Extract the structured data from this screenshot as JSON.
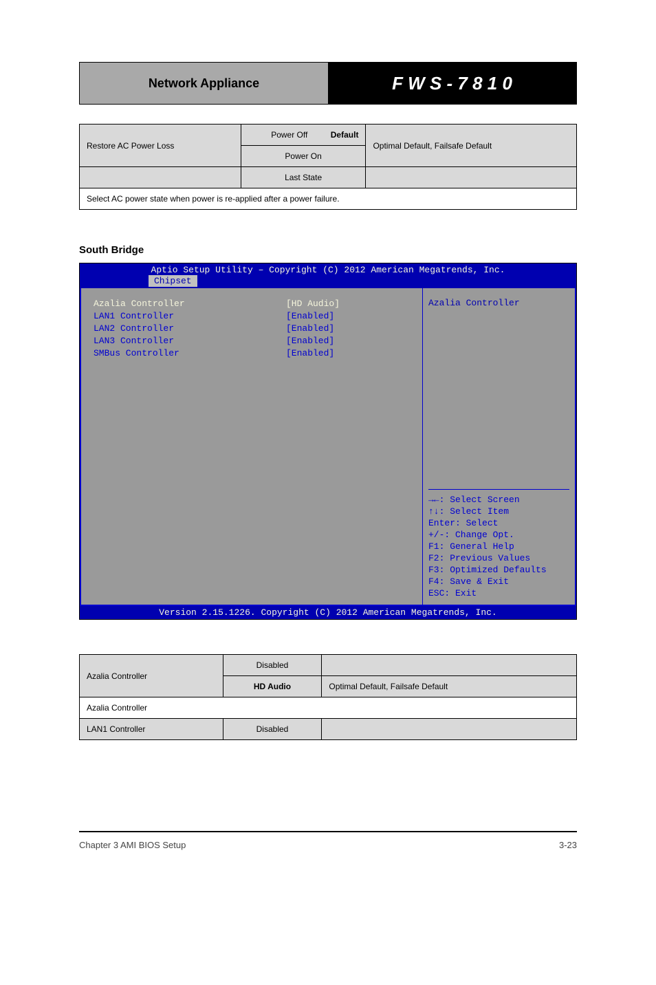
{
  "header": {
    "left": "Network Appliance",
    "right": "F W S - 7 8 1 0"
  },
  "table1": {
    "r1c1": "Restore AC Power Loss",
    "r1c2a": "Power Off",
    "r1c2b": "Power On",
    "r1c3a": "Default",
    "r1c3b": "Optimal Default, Failsafe Default",
    "r2c1": "",
    "r2c2": "Last State",
    "r2c3": "",
    "note": "Select AC power state when power is re-applied after a power failure."
  },
  "section_title": "South Bridge",
  "bios": {
    "title": "Aptio Setup Utility – Copyright (C) 2012 American Megatrends, Inc.",
    "tab": "Chipset",
    "rows": [
      {
        "label": "Azalia Controller",
        "value": "[HD Audio]",
        "selected": true
      },
      {
        "label": "LAN1 Controller",
        "value": "[Enabled]",
        "selected": false
      },
      {
        "label": "LAN2 Controller",
        "value": "[Enabled]",
        "selected": false
      },
      {
        "label": "LAN3 Controller",
        "value": "[Enabled]",
        "selected": false
      },
      {
        "label": "SMBus Controller",
        "value": "[Enabled]",
        "selected": false
      }
    ],
    "help_title": "Azalia Controller",
    "keys": [
      "→←: Select Screen",
      "↑↓: Select Item",
      "Enter: Select",
      "+/-: Change Opt.",
      "F1: General Help",
      "F2: Previous Values",
      "F3: Optimized Defaults",
      "F4: Save & Exit",
      "ESC: Exit"
    ],
    "footer": "Version 2.15.1226. Copyright (C) 2012 American Megatrends, Inc."
  },
  "table2": {
    "r1c1": "Azalia Controller",
    "r1c2a": "Disabled",
    "r1c2b": "HD Audio",
    "r1c3": "Optimal Default, Failsafe Default",
    "note": "Azalia Controller",
    "r3c1": "LAN1 Controller",
    "r3c2": "Disabled",
    "r3c3": ""
  },
  "footer": {
    "left": "Chapter 3 AMI BIOS Setup",
    "right": "3-23"
  }
}
